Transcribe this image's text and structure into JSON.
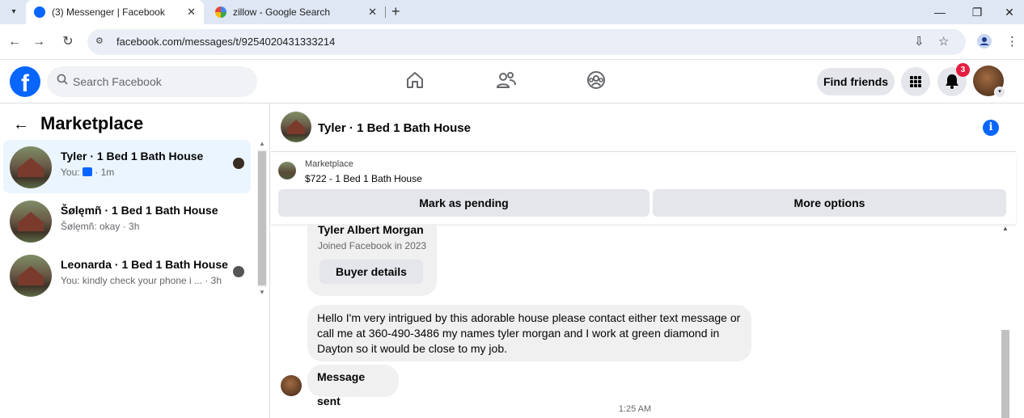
{
  "browser": {
    "tabs": [
      {
        "title": "(3) Messenger | Facebook",
        "icon": "facebook-icon",
        "active": true
      },
      {
        "title": "zillow - Google Search",
        "icon": "google-icon",
        "active": false
      }
    ],
    "url": "facebook.com/messages/t/9254020431333214",
    "new_tab": "+",
    "close_glyph": "✕"
  },
  "fb": {
    "search_placeholder": "Search Facebook",
    "find_friends_label": "Find friends",
    "notification_count": "3",
    "brand_color": "#0866ff"
  },
  "sidebar": {
    "title": "Marketplace",
    "conversations": [
      {
        "name": "Tyler · 1 Bed 1 Bath House",
        "preview_prefix": "You: ",
        "preview_suffix": " · 1m",
        "selected": true
      },
      {
        "name": "Šølęmñ · 1 Bed 1 Bath House",
        "preview": "Šølęmñ: okay · 3h",
        "selected": false
      },
      {
        "name": "Leonarda · 1 Bed 1 Bath House",
        "preview": "You: kindly check your phone i ...  · 3h",
        "selected": false
      }
    ]
  },
  "chat": {
    "title": "Tyler · 1 Bed 1 Bath House",
    "listing": {
      "label": "Marketplace",
      "price_title": "$722 - 1 Bed 1 Bath House",
      "mark_pending": "Mark as pending",
      "more_options": "More options"
    },
    "profile": {
      "name": "Tyler Albert Morgan",
      "joined": "Joined Facebook in 2023",
      "buyer_details": "Buyer details"
    },
    "messages": [
      {
        "text": "Hello I'm very intrigued by this adorable house please contact either text message or call me at 360-490-3486 my names tyler morgan and I work at green diamond in Dayton so it would be close to my job."
      },
      {
        "text": "Message sent"
      }
    ],
    "timestamp": "1:25 AM"
  }
}
